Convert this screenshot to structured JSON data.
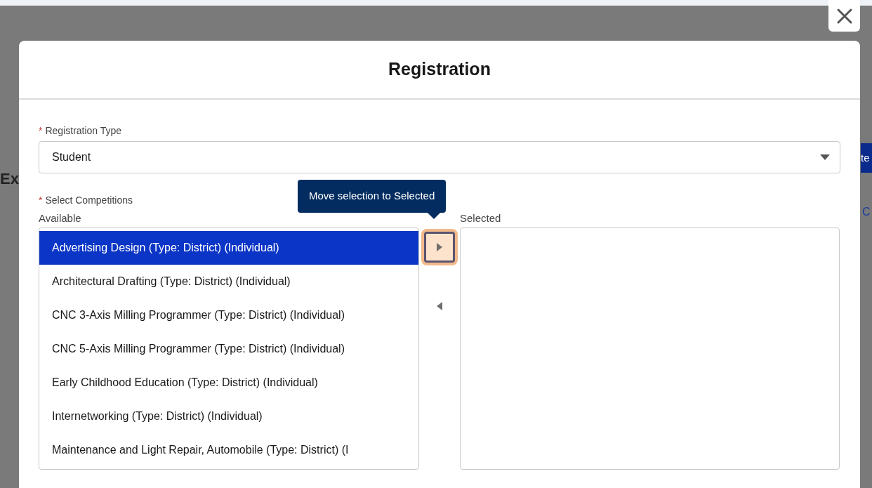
{
  "background": {
    "heading_fragment": "Ex",
    "button_fragment": "te",
    "link_fragment": "C"
  },
  "modal": {
    "title": "Registration",
    "registration_type": {
      "required_mark": "*",
      "label": "Registration Type",
      "value": "Student"
    },
    "competitions": {
      "required_mark": "*",
      "label": "Select Competitions",
      "available_label": "Available",
      "selected_label": "Selected",
      "tooltip": "Move selection to Selected",
      "move_right_focused": true,
      "available": [
        {
          "label": "Advertising Design (Type: District) (Individual)",
          "selected": true
        },
        {
          "label": "Architectural Drafting (Type: District) (Individual)",
          "selected": false
        },
        {
          "label": "CNC 3-Axis Milling Programmer (Type: District) (Individual)",
          "selected": false
        },
        {
          "label": "CNC 5-Axis Milling Programmer (Type: District) (Individual)",
          "selected": false
        },
        {
          "label": "Early Childhood Education (Type: District) (Individual)",
          "selected": false
        },
        {
          "label": "Internetworking (Type: District) (Individual)",
          "selected": false
        },
        {
          "label": "Maintenance and Light Repair, Automobile (Type: District) (I",
          "selected": false
        }
      ]
    }
  }
}
